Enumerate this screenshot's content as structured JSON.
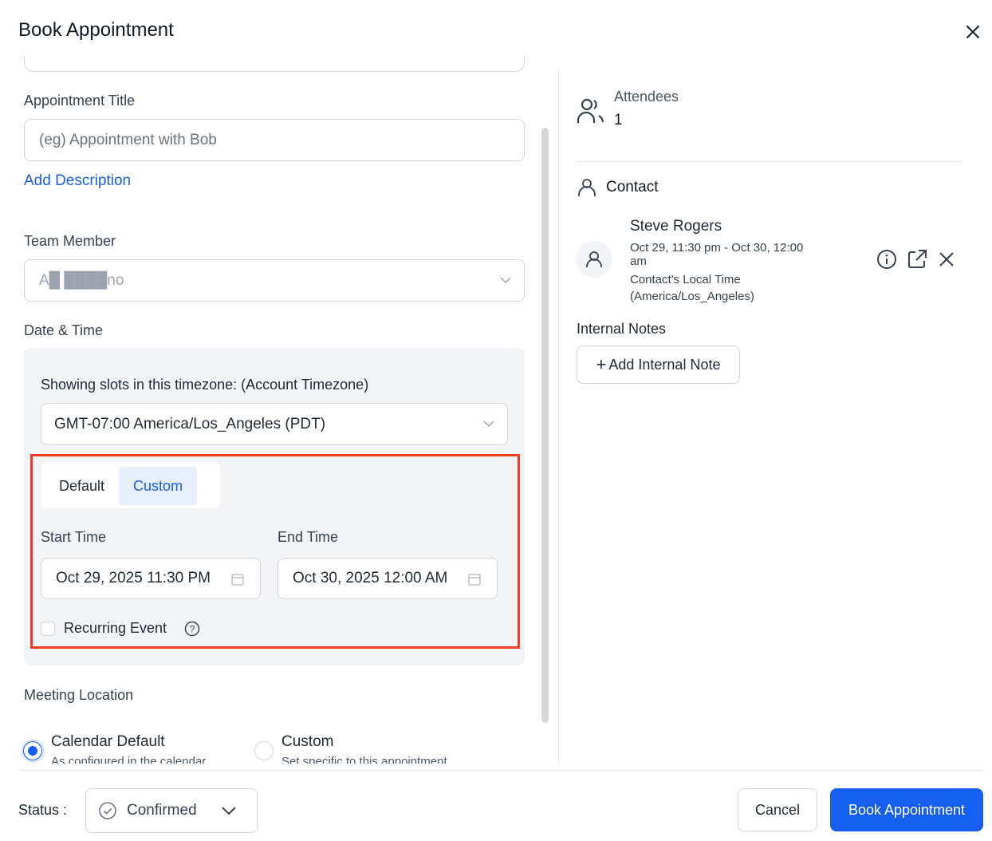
{
  "header": {
    "title": "Book Appointment"
  },
  "form": {
    "appointment_title_label": "Appointment Title",
    "appointment_title_placeholder": "(eg) Appointment with Bob",
    "add_description": "Add Description",
    "team_member_label": "Team Member",
    "team_member_value": "A█ ████no",
    "date_time_label": "Date & Time",
    "timezone_label": "Showing slots in this timezone: (Account Timezone)",
    "timezone_value": "GMT-07:00 America/Los_Angeles (PDT)",
    "tabs": [
      {
        "label": "Default",
        "active": false
      },
      {
        "label": "Custom",
        "active": true
      }
    ],
    "start_time_label": "Start Time",
    "start_time_value": "Oct 29, 2025 11:30 PM",
    "end_time_label": "End Time",
    "end_time_value": "Oct 30, 2025 12:00 AM",
    "recurring_label": "Recurring Event",
    "meeting_location_label": "Meeting Location",
    "location_options": [
      {
        "label": "Calendar Default",
        "sub": "As configured in the calendar",
        "selected": true
      },
      {
        "label": "Custom",
        "sub": "Set specific to this appointment",
        "selected": false
      }
    ]
  },
  "side": {
    "attendees_label": "Attendees",
    "attendees_count": "1",
    "contact_label": "Contact",
    "contact_name": "Steve Rogers",
    "contact_time": "Oct 29, 11:30 pm - Oct 30, 12:00 am",
    "contact_local": "Contact's Local Time (America/Los_Angeles)",
    "internal_notes_label": "Internal Notes",
    "add_note": "Add Internal Note"
  },
  "footer": {
    "status_label": "Status :",
    "status_value": "Confirmed",
    "cancel": "Cancel",
    "book": "Book Appointment"
  },
  "colors": {
    "accent": "#155eef",
    "highlight": "#ef3b24"
  }
}
